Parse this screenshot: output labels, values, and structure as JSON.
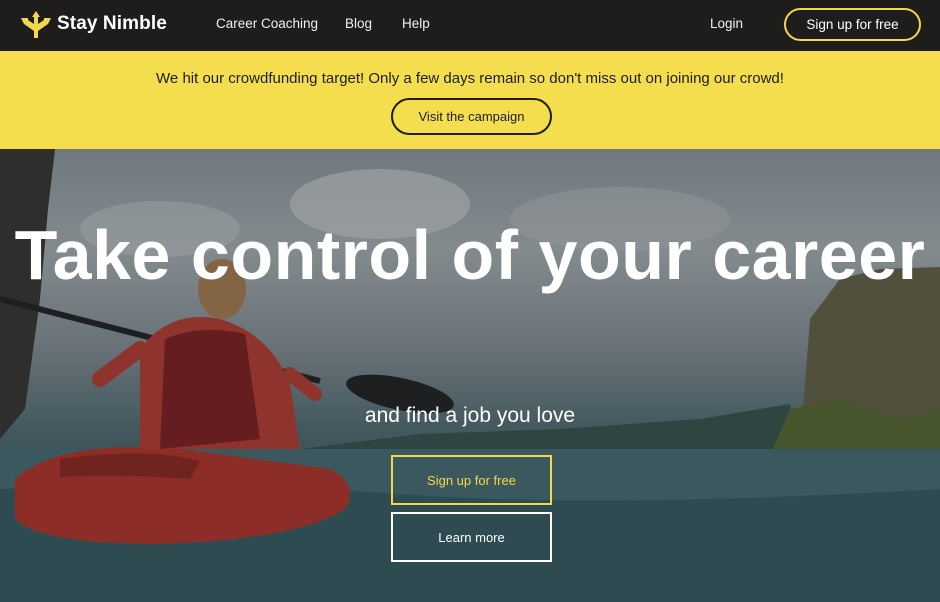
{
  "nav": {
    "brand": "Stay Nimble",
    "logo_icon": "stay-nimble-arrow-logo",
    "links": [
      "Career Coaching",
      "Blog",
      "Help"
    ],
    "login": "Login",
    "signup": "Sign up for free"
  },
  "banner": {
    "message": "We hit our crowdfunding target! Only a few days remain so don't miss out on joining our crowd!",
    "button": "Visit the campaign",
    "background": "#f4de4d"
  },
  "hero": {
    "title": "Take control of your career",
    "subtitle": "and find a job you love",
    "primary_button": "Sign up for free",
    "secondary_button": "Learn more",
    "accent": "#f2d84b"
  }
}
